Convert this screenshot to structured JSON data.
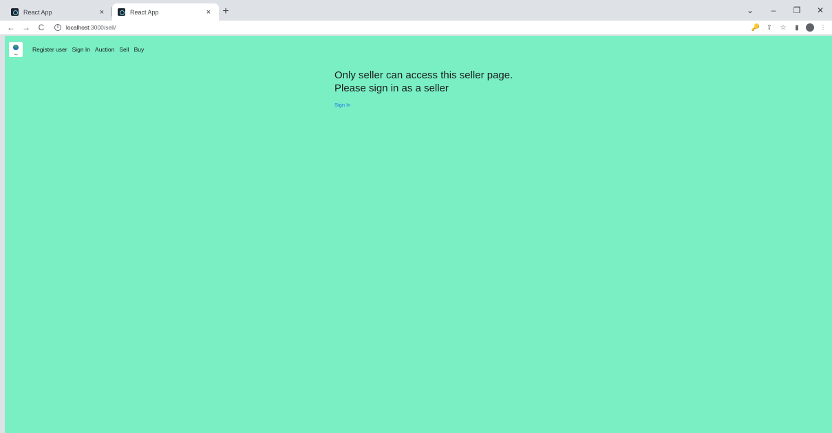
{
  "browser": {
    "tabs": [
      {
        "title": "React App",
        "close": "×"
      },
      {
        "title": "React App",
        "close": "×"
      }
    ],
    "new_tab": "+",
    "window_controls": {
      "chevron": "⌄",
      "minimize": "–",
      "restore": "❐",
      "close": "✕"
    },
    "toolbar": {
      "back": "←",
      "forward": "→",
      "reload": "C",
      "info": "i",
      "url_host": "localhost",
      "url_path": ":3000/sell/",
      "icons": {
        "key": "🔑",
        "share": "⇪",
        "star": "☆",
        "sidebar": "▮",
        "menu": "⋮"
      }
    }
  },
  "page": {
    "logo_text": "logo",
    "nav": [
      "Register user",
      "Sign In",
      "Auction",
      "Sell",
      "Buy"
    ],
    "message": "Only seller can access this seller page. Please sign in as a seller",
    "signin_link": "Sign In",
    "background_color": "#79efc3"
  }
}
